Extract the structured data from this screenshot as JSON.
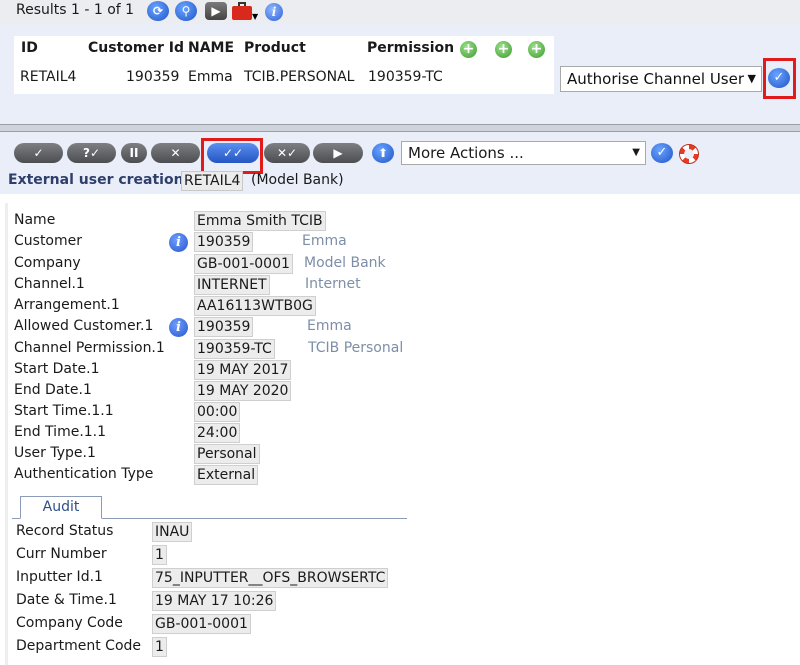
{
  "results": {
    "summary": "Results 1 - 1 of 1",
    "columns": [
      "ID",
      "Customer Id",
      "NAME",
      "Product",
      "Permission"
    ],
    "row": {
      "id": "RETAIL4",
      "customer_id": "190359",
      "name": "Emma",
      "product": "TCIB.PERSONAL",
      "permission": "190359-TC"
    },
    "action_select": "Authorise Channel User",
    "icons": [
      "refresh-icon",
      "search-icon",
      "next-icon",
      "toolbox-icon",
      "info-icon",
      "add-icon",
      "add-icon",
      "add-icon",
      "confirm-icon"
    ]
  },
  "toolbar": {
    "buttons": [
      {
        "name": "commit-button",
        "label": "✓"
      },
      {
        "name": "validate-button",
        "label": "?✓"
      },
      {
        "name": "hold-button",
        "label": "II"
      },
      {
        "name": "delete-button",
        "label": "✕"
      },
      {
        "name": "authorise-button",
        "label": "✓✓"
      },
      {
        "name": "reverse-button",
        "label": "✕✓"
      },
      {
        "name": "next-button",
        "label": "▶"
      }
    ],
    "more_actions": "More Actions ...",
    "icons": [
      "upload-icon",
      "confirm-icon",
      "help-icon"
    ]
  },
  "transaction": {
    "title": "External user creation",
    "id": "RETAIL4",
    "company": "(Model Bank)"
  },
  "fields": [
    {
      "label": "Name",
      "value": "Emma Smith TCIB",
      "enrich": ""
    },
    {
      "label": "Customer",
      "value": "190359",
      "enrich": "Emma",
      "info": true
    },
    {
      "label": "Company",
      "value": "GB-001-0001",
      "enrich": "Model Bank"
    },
    {
      "label": "Channel.1",
      "value": "INTERNET",
      "enrich": "Internet"
    },
    {
      "label": "Arrangement.1",
      "value": "AA16113WTB0G",
      "enrich": ""
    },
    {
      "label": "Allowed Customer.1",
      "value": "190359",
      "enrich": "Emma",
      "info": true
    },
    {
      "label": "Channel Permission.1",
      "value": "190359-TC",
      "enrich": "TCIB Personal"
    },
    {
      "label": "Start Date.1",
      "value": "19 MAY 2017",
      "enrich": ""
    },
    {
      "label": "End Date.1",
      "value": "19 MAY 2020",
      "enrich": ""
    },
    {
      "label": "Start Time.1.1",
      "value": "00:00",
      "enrich": ""
    },
    {
      "label": "End Time.1.1",
      "value": "24:00",
      "enrich": ""
    },
    {
      "label": "User Type.1",
      "value": "Personal",
      "enrich": ""
    },
    {
      "label": "Authentication Type",
      "value": "External",
      "enrich": ""
    }
  ],
  "audit": {
    "tab_label": "Audit",
    "fields": [
      {
        "label": "Record Status",
        "value": "INAU"
      },
      {
        "label": "Curr Number",
        "value": "1"
      },
      {
        "label": "Inputter Id.1",
        "value": "75_INPUTTER__OFS_BROWSERTC"
      },
      {
        "label": "Date & Time.1",
        "value": "19 MAY 17 10:26"
      },
      {
        "label": "Company Code",
        "value": "GB-001-0001"
      },
      {
        "label": "Department Code",
        "value": "1"
      }
    ]
  },
  "colors": {
    "pane_bg": "#e9eef9",
    "enrich_text": "#7d8ea8",
    "highlight_frame": "#e01b1b",
    "button_dark": "#4b4d51",
    "button_active": "#2455c2"
  }
}
